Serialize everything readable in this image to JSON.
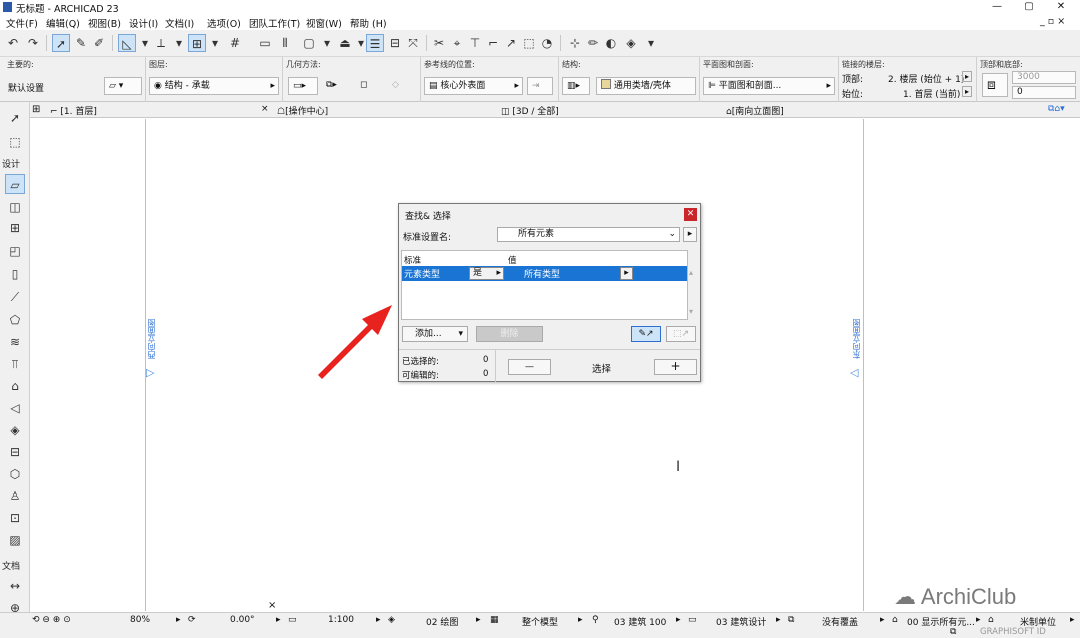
{
  "window": {
    "title": "无标题 - ARCHICAD 23",
    "min": "—",
    "max": "▢",
    "close": "✕",
    "mdi_controls": "_ ▫ ×"
  },
  "menu": [
    "文件(F)",
    "编辑(Q)",
    "视图(B)",
    "设计(I)",
    "文档(I)",
    "选项(O)",
    "团队工作(T)",
    "视窗(W)",
    "帮助 (H)"
  ],
  "infobox": {
    "main_label": "主要的:",
    "default_setting": "默认设置",
    "layer_label": "图层:",
    "layer_value": "结构 - 承载",
    "geometry_label": "几何方法:",
    "ref_line_label": "参考线的位置:",
    "ref_line_value": "核心外表面",
    "structure_label": "结构:",
    "structure_value": "通用类墙/壳体",
    "plan_section_label": "平面图和剖面:",
    "plan_section_value": "平面图和剖面...",
    "linked_stories_label": "链接的楼层:",
    "top_label": "顶部:",
    "top_value": "2. 楼层 (始位 + 1)",
    "base_label": "始位:",
    "base_value": "1. 首层 (当前)",
    "top_offset_label": "顶部和底部:",
    "height_value": "3000",
    "offset_value": "0"
  },
  "tabs": [
    {
      "label": "[1. 首层]"
    },
    {
      "label": "[操作中心]"
    },
    {
      "label": "[3D / 全部]"
    },
    {
      "label": "[南向立面图]"
    }
  ],
  "toolbox": {
    "select_section": "设计",
    "doc_section": "文档"
  },
  "canvas": {
    "west_label": "西向立面图",
    "east_label": "东向立面图"
  },
  "dialog": {
    "title": "查找& 选择",
    "criteria_set_label": "标准设置名:",
    "criteria_set_value": "所有元素",
    "col_criteria": "标准",
    "col_value": "值",
    "row_criteria": "元素类型",
    "row_operator": "是",
    "row_value": "所有类型",
    "add_button": "添加...",
    "delete_button": "删除",
    "selected_label": "已选择的:",
    "selected_count": "0",
    "editable_label": "可编辑的:",
    "editable_count": "0",
    "minus_button": "—",
    "select_label": "选择",
    "plus_button": "+"
  },
  "statusbar": {
    "zoom": "80%",
    "angle": "0.00°",
    "scale": "1:100",
    "layer_combo": "02 绘图",
    "model": "整个模型",
    "pen_set": "03 建筑 100",
    "mvo": "03 建筑设计",
    "override": "没有覆盖",
    "renovation": "00 显示所有元...",
    "units": "米制单位",
    "graphisoft": "GRAPHISOFT ID"
  },
  "watermark": "ArchiClub"
}
